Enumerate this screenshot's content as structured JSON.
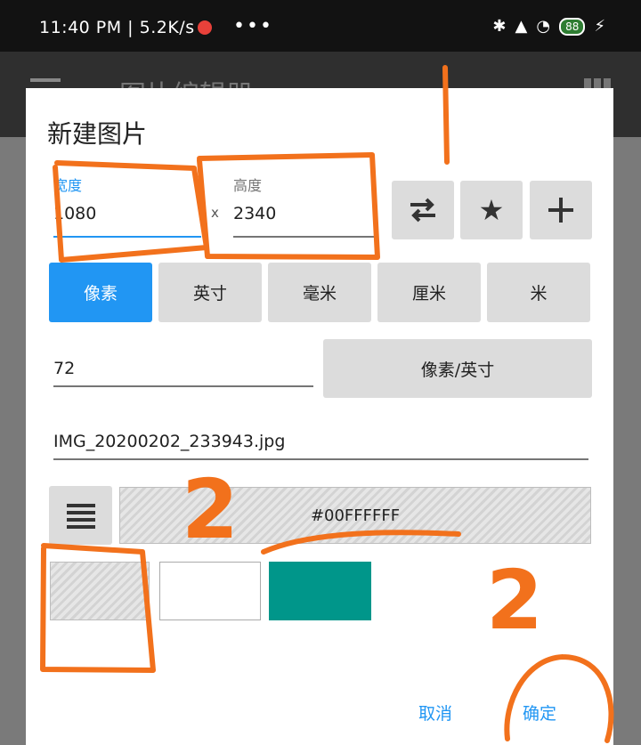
{
  "status_bar": {
    "time": "11:40 PM | 5.2K/s",
    "dots": "•••",
    "battery": "88",
    "icons": [
      "bluetooth-icon",
      "signal-icon",
      "wifi-icon",
      "battery-icon",
      "charging-icon"
    ]
  },
  "app_bar": {
    "title": "图片编辑器",
    "icons": [
      "menu-icon",
      "grid-icon"
    ]
  },
  "dialog": {
    "title": "新建图片",
    "width": {
      "label": "宽度",
      "value": "1080"
    },
    "times": "x",
    "height": {
      "label": "高度",
      "value": "2340"
    },
    "icon_buttons": [
      "swap-icon",
      "star-icon",
      "plus-icon"
    ],
    "units": [
      "像素",
      "英寸",
      "毫米",
      "厘米",
      "米"
    ],
    "active_unit": "像素",
    "resolution": {
      "value": "72",
      "unit_button": "像素/英寸"
    },
    "filename": "IMG_20200202_233943.jpg",
    "color": {
      "menu_icon": "list-icon",
      "value": "#00FFFFFF",
      "swatches": [
        "transparent",
        "#FFFFFF",
        "#00968A"
      ]
    },
    "cancel": "取消",
    "ok": "确定"
  },
  "annotations": {
    "marks": [
      "1",
      "2",
      "2"
    ],
    "color": "#F2711C"
  },
  "colors": {
    "accent": "#2196F3",
    "annotation": "#F2711C"
  }
}
